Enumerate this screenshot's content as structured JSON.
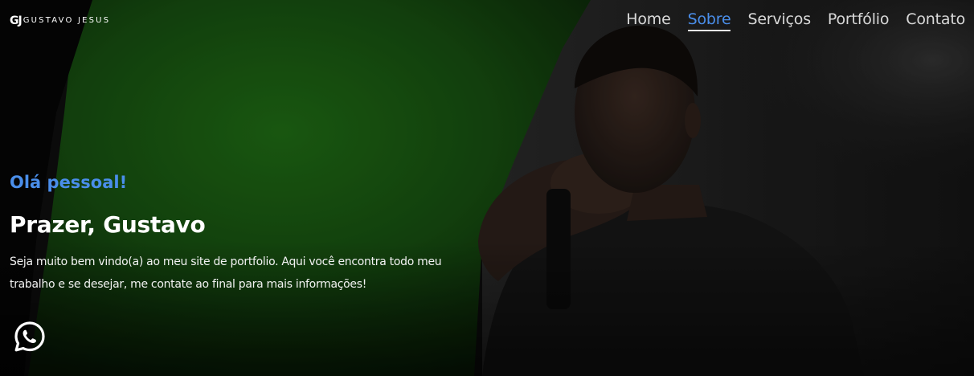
{
  "brand": {
    "mark": "GJ",
    "name": "GUSTAVO JESUS"
  },
  "nav": {
    "items": [
      {
        "label": "Home",
        "active": false
      },
      {
        "label": "Sobre",
        "active": true
      },
      {
        "label": "Serviços",
        "active": false
      },
      {
        "label": "Portfólio",
        "active": false
      },
      {
        "label": "Contato",
        "active": false
      }
    ]
  },
  "hero": {
    "greeting": "Olá pessoal!",
    "headline": "Prazer, Gustavo",
    "intro": "Seja muito bem vindo(a) ao meu site de portfolio. Aqui você encontra todo meu trabalho e se desejar, me contate ao final para mais informações!"
  },
  "floating": {
    "icon": "whatsapp-icon"
  },
  "colors": {
    "accent": "#4a8eea",
    "background": "#0b0b0b",
    "green_screen": "#1a5a12"
  }
}
